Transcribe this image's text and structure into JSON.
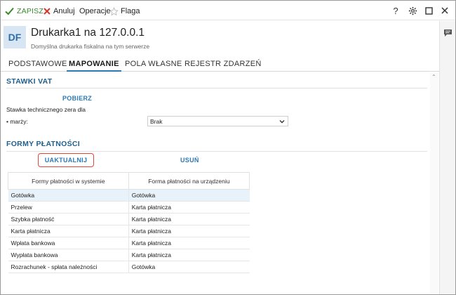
{
  "toolbar": {
    "save_label": "ZAPISZ",
    "cancel_label": "Anuluj",
    "operations_label": "Operacje",
    "flag_label": "Flaga",
    "help_label": "?"
  },
  "header": {
    "avatar": "DF",
    "title": "Drukarka1 na 127.0.0.1",
    "subtitle": "Domyślna drukarka fiskalna na tym serwerze"
  },
  "tabs": [
    {
      "label": "PODSTAWOWE"
    },
    {
      "label": "MAPOWANIE"
    },
    {
      "label": "POLA WŁASNE"
    },
    {
      "label": "REJESTR ZDARZEŃ"
    }
  ],
  "vat_section": {
    "title": "STAWKI VAT",
    "fetch_label": "POBIERZ",
    "rate_label_line1": "Stawka technicznego zera dla",
    "rate_label_line2": "• marży:",
    "rate_value": "Brak"
  },
  "payment_section": {
    "title": "FORMY PŁATNOŚCI",
    "update_label": "UAKTUALNIJ",
    "delete_label": "USUŃ",
    "columns": [
      "Formy płatności w systemie",
      "Forma płatności na urządzeniu"
    ],
    "rows": [
      [
        "Gotówka",
        "Gotówka"
      ],
      [
        "Przelew",
        "Karta płatnicza"
      ],
      [
        "Szybka płatność",
        "Karta płatnicza"
      ],
      [
        "Karta płatnicza",
        "Karta płatnicza"
      ],
      [
        "Wpłata bankowa",
        "Karta płatnicza"
      ],
      [
        "Wypłata bankowa",
        "Karta płatnicza"
      ],
      [
        "Rozrachunek - spłata należności",
        "Gotówka"
      ]
    ]
  },
  "colors": {
    "accent": "#2a7ab8",
    "save_green": "#3a8a2a",
    "cancel_red": "#d9342b",
    "highlight_border": "#e0463a",
    "selected_row": "#e8f2fa"
  }
}
